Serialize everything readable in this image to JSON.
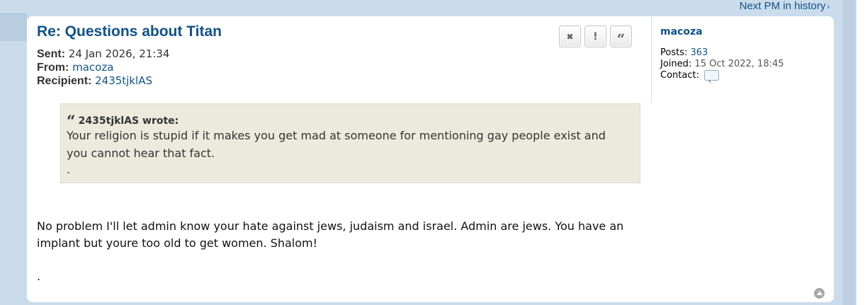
{
  "nav": {
    "next_pm": "Next PM in history",
    "next_arrow": "›"
  },
  "post": {
    "subject": "Re: Questions about Titan",
    "sent_label": "Sent:",
    "sent_value": "24 Jan 2026, 21:34",
    "from_label": "From:",
    "from_value": "macoza",
    "recipient_label": "Recipient:",
    "recipient_value": "2435tjklAS",
    "actions": {
      "delete": "✖",
      "report": "!",
      "quote": "“"
    },
    "quote": {
      "mark": "“",
      "author": "2435tjklAS wrote:",
      "text": "Your religion is stupid if it makes you get mad at someone for mentioning gay people exist and you cannot hear that fact.",
      "trailing": "."
    },
    "body": "No problem I'll let admin know your hate against jews, judaism and israel. Admin are jews. You have an implant but youre too old to get women. Shalom!",
    "body_trailing": "."
  },
  "profile": {
    "username": "macoza",
    "posts_label": "Posts:",
    "posts_value": "363",
    "joined_label": "Joined:",
    "joined_value": "15 Oct 2022, 18:45",
    "contact_label": "Contact:"
  },
  "colors": {
    "link": "#105289",
    "page_bg": "#cadceb",
    "quote_bg": "#ebeadd"
  }
}
